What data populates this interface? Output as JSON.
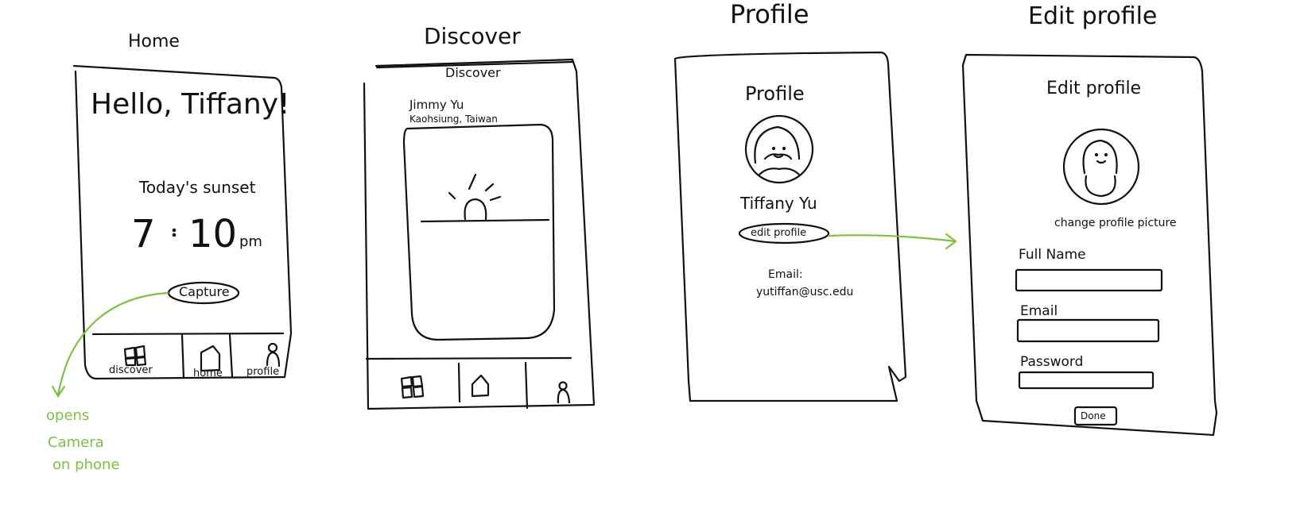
{
  "colors": {
    "ink": "#111111",
    "annotation": "#7cc242"
  },
  "screens": {
    "home": {
      "title": "Home",
      "greeting": "Hello, Tiffany!",
      "sunset_label": "Today's sunset",
      "time_hours": "7",
      "time_sep": ":",
      "time_minutes": "10",
      "time_suffix": "pm",
      "capture_button": "Capture",
      "nav": {
        "discover": "discover",
        "home": "home",
        "profile": "profile"
      }
    },
    "discover": {
      "title": "Discover",
      "header": "Discover",
      "post_author": "Jimmy Yu",
      "post_location": "Kaohsiung, Taiwan"
    },
    "profile": {
      "title": "Profile",
      "header": "Profile",
      "name": "Tiffany Yu",
      "edit_button": "edit profile",
      "email_label": "Email:",
      "email_value": "yutiffan@usc.edu"
    },
    "edit_profile": {
      "title": "Edit profile",
      "header": "Edit profile",
      "change_picture": "change profile picture",
      "full_name_label": "Full Name",
      "email_label": "Email",
      "password_label": "Password",
      "done_button": "Done"
    }
  },
  "annotation": {
    "line1": "opens",
    "line2": "Camera",
    "line3": "on phone"
  }
}
